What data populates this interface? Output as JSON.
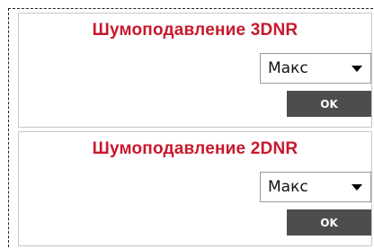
{
  "sections": [
    {
      "title": "Шумоподавление 3DNR",
      "select_value": "Макс",
      "button_label": "OK"
    },
    {
      "title": "Шумоподавление 2DNR",
      "select_value": "Макс",
      "button_label": "OK"
    }
  ],
  "colors": {
    "title": "#c8182d",
    "button_bg": "#4d4d4d",
    "button_text": "#ffffff"
  },
  "icons": {
    "dropdown": "chevron-down-icon"
  }
}
